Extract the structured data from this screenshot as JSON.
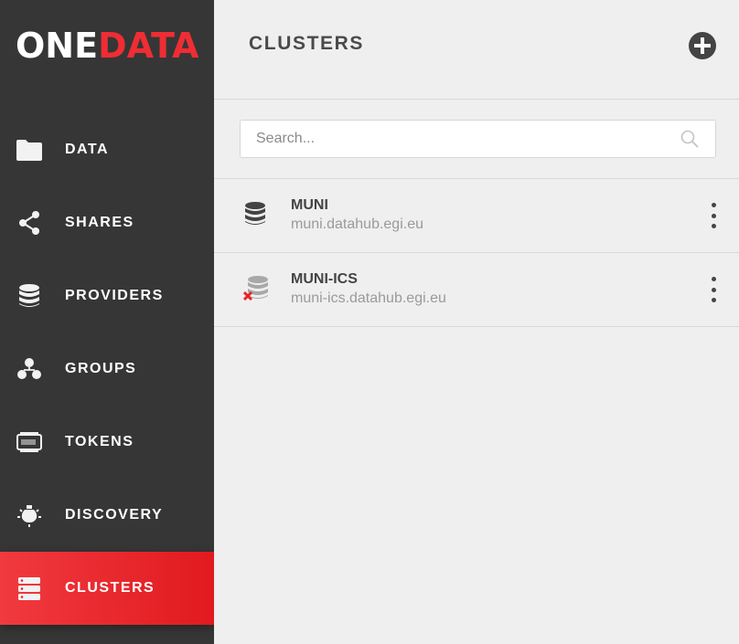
{
  "logo": {
    "part1": "ONE",
    "part2": "DATA"
  },
  "sidebar": {
    "items": [
      {
        "label": "DATA",
        "icon": "folder-icon"
      },
      {
        "label": "SHARES",
        "icon": "share-icon"
      },
      {
        "label": "PROVIDERS",
        "icon": "database-icon"
      },
      {
        "label": "GROUPS",
        "icon": "groups-icon"
      },
      {
        "label": "TOKENS",
        "icon": "token-icon"
      },
      {
        "label": "DISCOVERY",
        "icon": "discovery-icon"
      },
      {
        "label": "CLUSTERS",
        "icon": "clusters-icon",
        "active": true
      }
    ]
  },
  "header": {
    "title": "CLUSTERS",
    "add_icon": "plus-circle-icon"
  },
  "search": {
    "placeholder": "Search...",
    "value": ""
  },
  "clusters": [
    {
      "name": "MUNI",
      "domain": "muni.datahub.egi.eu",
      "status": "online"
    },
    {
      "name": "MUNI-ICS",
      "domain": "muni-ics.datahub.egi.eu",
      "status": "offline"
    }
  ],
  "colors": {
    "sidebar_bg": "#363636",
    "accent": "#e8242a",
    "main_bg": "#efefef",
    "offline_mark": "#e8242a"
  }
}
